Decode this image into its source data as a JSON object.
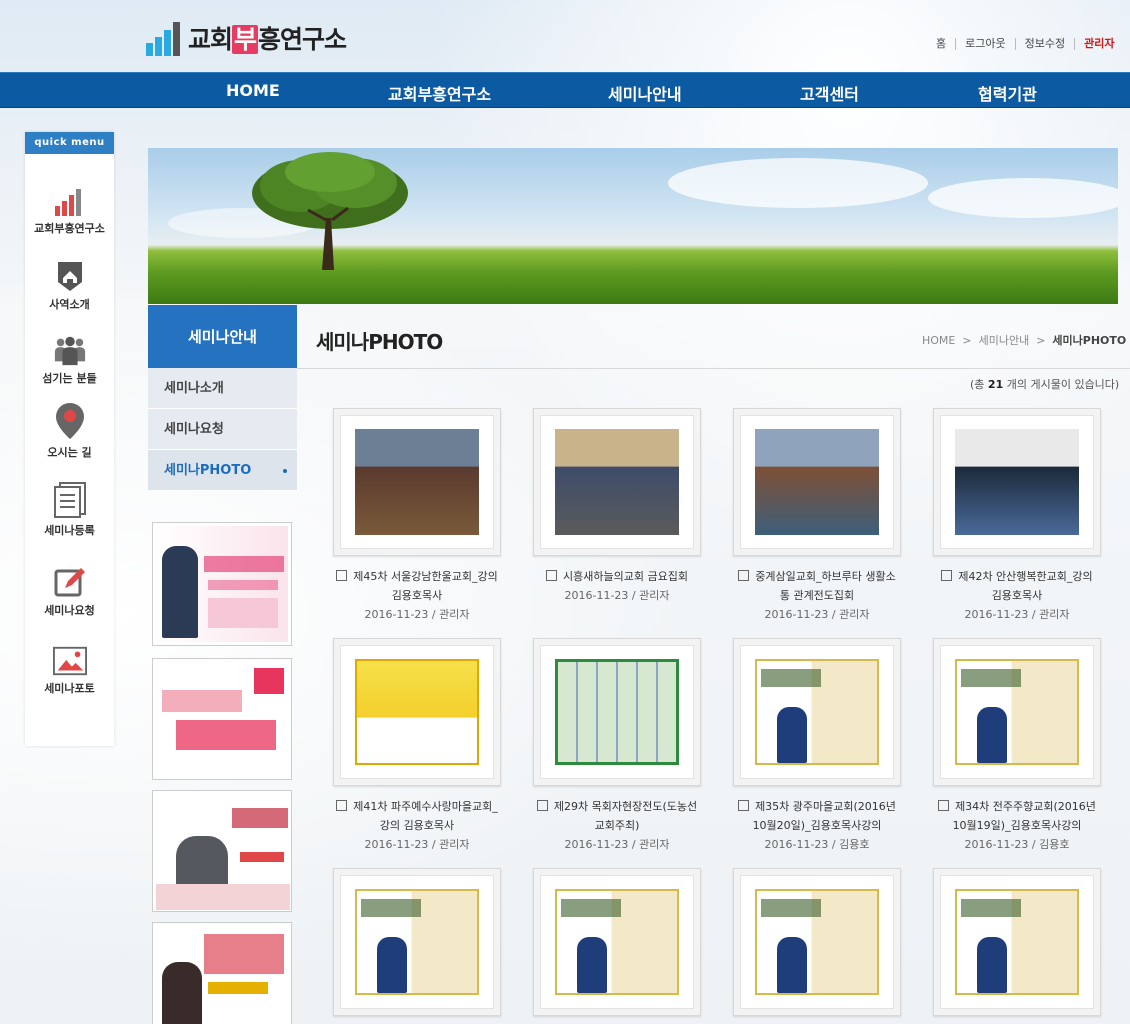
{
  "header": {
    "logo_text": [
      "교회",
      "부",
      "흥연구소"
    ],
    "util": [
      "홈",
      "로그아웃",
      "정보수정",
      "관리자"
    ],
    "nav": [
      "HOME",
      "교회부흥연구소",
      "세미나안내",
      "고객센터",
      "협력기관"
    ]
  },
  "quick": {
    "title": "quick menu",
    "items": [
      {
        "label": "교회부흥연구소",
        "icon": "bar-chart-icon"
      },
      {
        "label": "사역소개",
        "icon": "home-icon"
      },
      {
        "label": "섬기는 분들",
        "icon": "people-icon"
      },
      {
        "label": "오시는 길",
        "icon": "map-pin-icon"
      },
      {
        "label": "세미나등록",
        "icon": "document-icon"
      },
      {
        "label": "세미나요청",
        "icon": "edit-icon"
      },
      {
        "label": "세미나포토",
        "icon": "photo-icon"
      }
    ]
  },
  "sidebar": {
    "title": "세미나안내",
    "items": [
      {
        "label": "세미나소개"
      },
      {
        "label": "세미나요청"
      },
      {
        "label": "세미나PHOTO"
      }
    ]
  },
  "content": {
    "title": "세미나PHOTO",
    "breadcrumb": [
      "HOME",
      "세미나안내",
      "세미나PHOTO"
    ],
    "count_prefix": "(총 ",
    "count_value": "21",
    "count_suffix": " 개의 게시물이 있습니다)",
    "posts": [
      {
        "title": "제45차 서울강남한울교회_강의 김용호목사",
        "meta": "2016-11-23 / 관리자"
      },
      {
        "title": "시흥새하늘의교회 금요집회",
        "meta": "2016-11-23 / 관리자"
      },
      {
        "title": "중계삼일교회_하브루타 생활소통 관계전도집회",
        "meta": "2016-11-23 / 관리자"
      },
      {
        "title": "제42차 안산행복한교회_강의 김용호목사",
        "meta": "2016-11-23 / 관리자"
      },
      {
        "title": "제41차 파주예수사랑마을교회_강의 김용호목사",
        "meta": "2016-11-23 / 관리자"
      },
      {
        "title": "제29차 목회자현장전도(도농선교회주최)",
        "meta": "2016-11-23 / 관리자"
      },
      {
        "title": "제35차 광주마을교회(2016년 10월20일)_김용호목사강의",
        "meta": "2016-11-23 / 김용호"
      },
      {
        "title": "제34차 전주주향교회(2016년 10월19일)_김용호목사강의",
        "meta": "2016-11-23 / 김용호"
      },
      {
        "title": "",
        "meta": ""
      },
      {
        "title": "",
        "meta": ""
      },
      {
        "title": "",
        "meta": ""
      },
      {
        "title": "",
        "meta": ""
      }
    ]
  },
  "colors": {
    "nav": "#0b5aa2",
    "accent": "#2472c0",
    "logo_hl": "#e63c64"
  }
}
